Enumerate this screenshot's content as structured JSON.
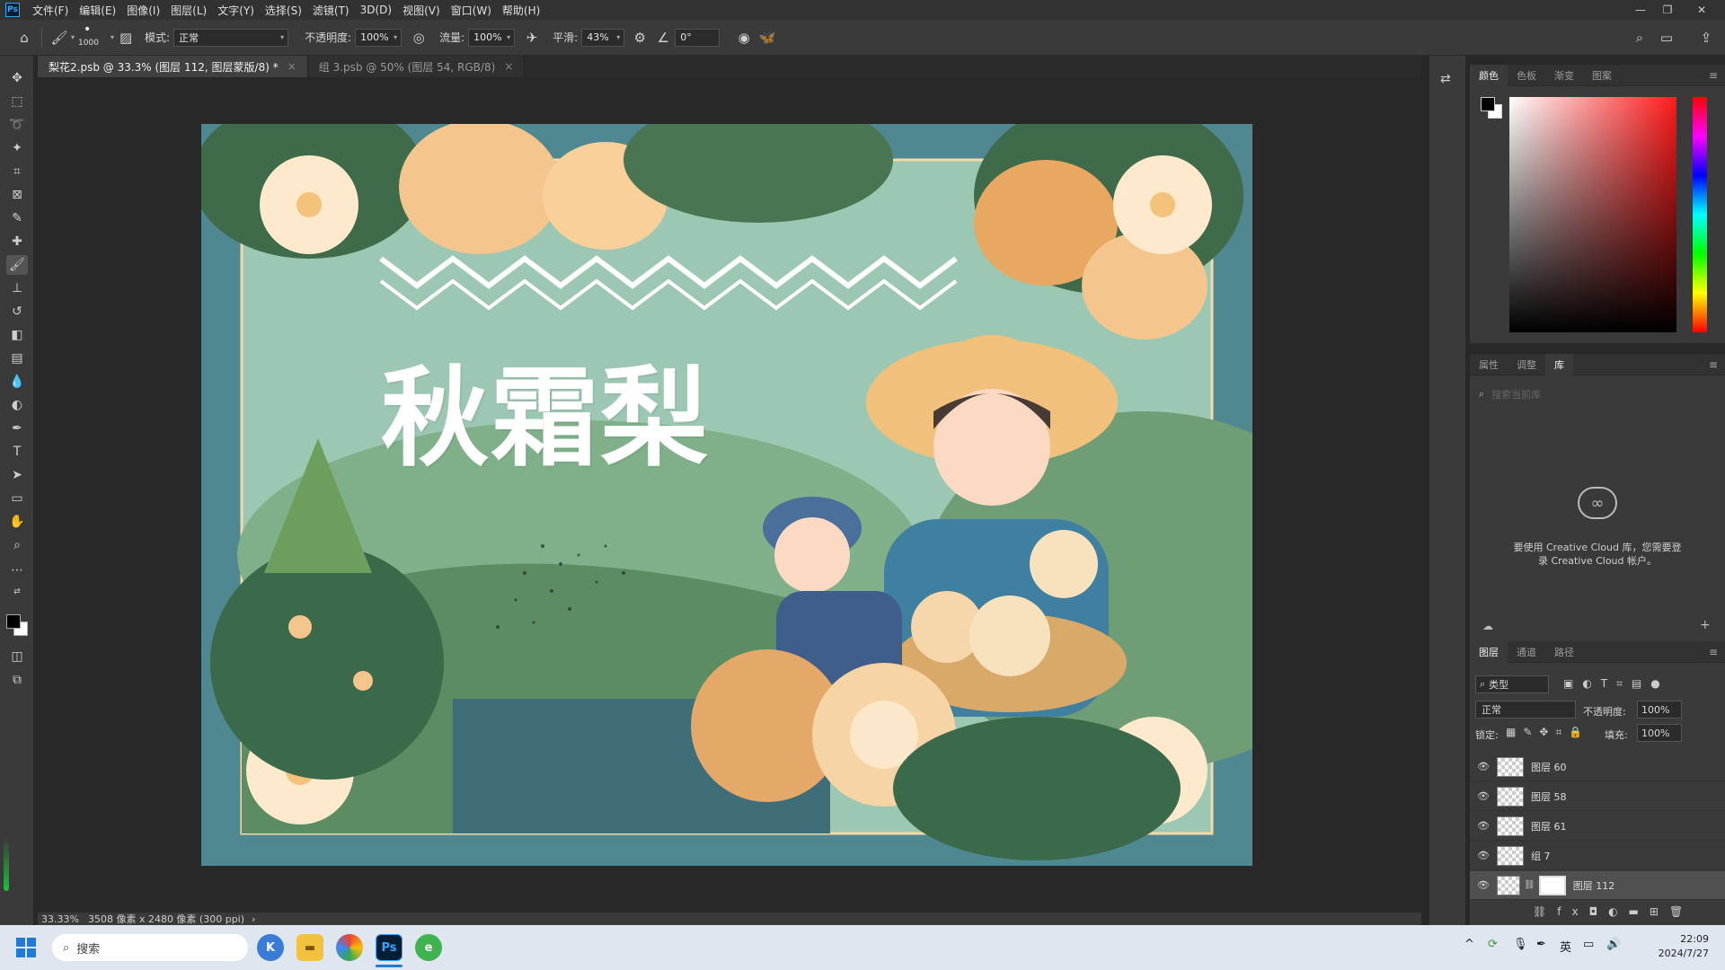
{
  "app": {
    "logo": "Ps"
  },
  "menubar": {
    "items": [
      "文件(F)",
      "编辑(E)",
      "图像(I)",
      "图层(L)",
      "文字(Y)",
      "选择(S)",
      "滤镜(T)",
      "3D(D)",
      "视图(V)",
      "窗口(W)",
      "帮助(H)"
    ]
  },
  "options": {
    "brush_size": "1000",
    "mode_label": "模式:",
    "mode_value": "正常",
    "opacity_label": "不透明度:",
    "opacity_value": "100%",
    "flow_label": "流量:",
    "flow_value": "100%",
    "smooth_label": "平滑:",
    "smooth_value": "43%",
    "angle_value": "0°"
  },
  "tabs": [
    {
      "label": "梨花2.psb @ 33.3% (图层 112, 图层蒙版/8) *",
      "close": "×"
    },
    {
      "label": "组 3.psb @ 50% (图层 54, RGB/8)",
      "close": "×"
    }
  ],
  "artwork": {
    "title": "秋霜梨"
  },
  "status": {
    "zoom": "33.33%",
    "size": "3508 像素 x 2480 像素 (300 ppi)",
    "arrow": "›"
  },
  "color_panel": {
    "tabs": [
      "颜色",
      "色板",
      "渐变",
      "图案"
    ]
  },
  "library_panel": {
    "tabs": [
      "属性",
      "调整",
      "库"
    ],
    "search_placeholder": "搜索当前库",
    "message_line1": "要使用 Creative Cloud 库，您需要登",
    "message_line2": "录 Creative Cloud 帐户。"
  },
  "layers_panel": {
    "tabs": [
      "图层",
      "通道",
      "路径"
    ],
    "filter_label": "类型",
    "blend_mode": "正常",
    "opacity_label": "不透明度:",
    "opacity_value": "100%",
    "lock_label": "锁定:",
    "fill_label": "填充:",
    "fill_value": "100%",
    "layers": [
      {
        "name": "图层 60"
      },
      {
        "name": "图层 58"
      },
      {
        "name": "图层 61"
      },
      {
        "name": "组 7"
      },
      {
        "name": "图层 112"
      }
    ],
    "footer_fx": "fx"
  },
  "taskbar": {
    "search_placeholder": "搜索",
    "ime": "英",
    "time": "22:09",
    "date": "2024/7/27"
  },
  "colors": {
    "canvas_bg": "#4f8891",
    "accent": "#31a8ff",
    "pear": "#f5cf9c",
    "leaf": "#3f6b4a"
  }
}
